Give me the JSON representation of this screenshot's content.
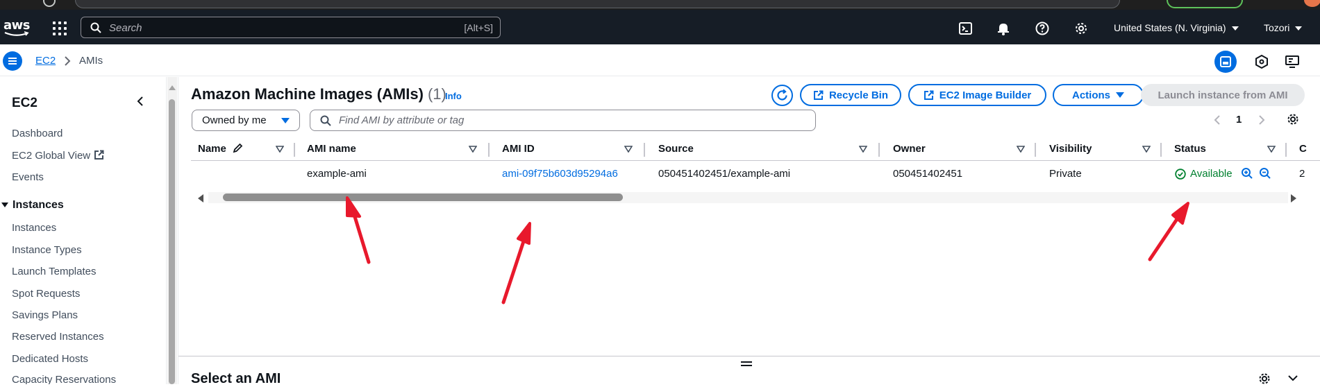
{
  "header": {
    "search_placeholder": "Search",
    "search_shortcut": "[Alt+S]",
    "region": "United States (N. Virginia)",
    "account": "Tozori"
  },
  "breadcrumb": {
    "service": "EC2",
    "current": "AMIs"
  },
  "sidebar": {
    "title": "EC2",
    "items_top": [
      "Dashboard",
      "EC2 Global View",
      "Events"
    ],
    "section": "Instances",
    "section_items": [
      "Instances",
      "Instance Types",
      "Launch Templates",
      "Spot Requests",
      "Savings Plans",
      "Reserved Instances",
      "Dedicated Hosts",
      "Capacity Reservations"
    ]
  },
  "main": {
    "title": "Amazon Machine Images (AMIs)",
    "count": "(1)",
    "info": "Info",
    "buttons": {
      "recycle_bin": "Recycle Bin",
      "image_builder": "EC2 Image Builder",
      "actions": "Actions",
      "launch": "Launch instance from AMI"
    },
    "filter": {
      "owner": "Owned by me",
      "find_placeholder": "Find AMI by attribute or tag"
    },
    "pagination": {
      "current_page": "1"
    },
    "table": {
      "columns": [
        "Name",
        "AMI name",
        "AMI ID",
        "Source",
        "Owner",
        "Visibility",
        "Status",
        "C"
      ],
      "rows": [
        {
          "name": "",
          "ami_name": "example-ami",
          "ami_id": "ami-09f75b603d95294a6",
          "source": "050451402451/example-ami",
          "owner": "050451402451",
          "visibility": "Private",
          "status": "Available",
          "creation": "2"
        }
      ]
    },
    "detail_panel_title": "Select an AMI"
  },
  "colors": {
    "nav_bg": "#161d26",
    "accent": "#006ce0",
    "success": "#00802f",
    "annotation_arrow": "#e8192c"
  }
}
